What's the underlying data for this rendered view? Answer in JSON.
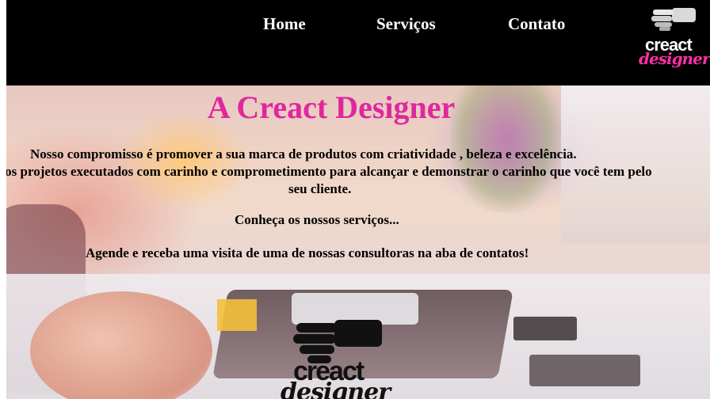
{
  "nav": {
    "items": [
      {
        "label": "Home"
      },
      {
        "label": "Serviços"
      },
      {
        "label": "Contato"
      }
    ]
  },
  "logo": {
    "word": "creact",
    "script": "designer"
  },
  "hero": {
    "title": "A Creact Designer",
    "lines": [
      "Nosso compromisso é promover a sua marca de produtos com criatividade , beleza e excelência.",
      "rsos projetos executados com carinho e comprometimento para alcançar e demonstrar o carinho que você tem pelo",
      "seu cliente.",
      "Conheça os nossos serviços...",
      "Agende e receba uma visita de uma de nossas consultoras na aba de contatos!"
    ]
  },
  "colors": {
    "navbar": "#000000",
    "title": "#e0279c",
    "logo_script": "#ff2ea8"
  }
}
